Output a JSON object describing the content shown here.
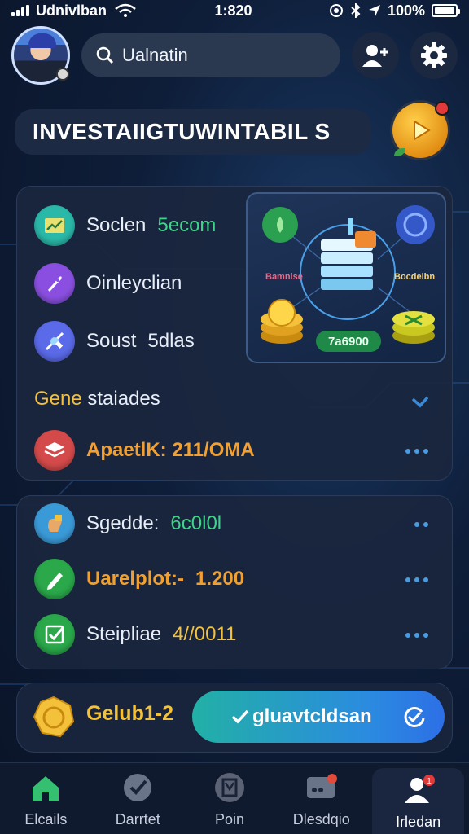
{
  "status_bar": {
    "carrier": "Udnivlban",
    "time": "1:820",
    "battery": "100%"
  },
  "header": {
    "search_placeholder": "Ualnatin"
  },
  "title_card": {
    "title": "INVESTAIIGTUWINTABIL S"
  },
  "panel1": {
    "items": [
      {
        "label": "Soclen",
        "value": "5ecom",
        "value_color": "#3ed48a",
        "icon": "chart-icon",
        "icon_bg": "#2ab8a8"
      },
      {
        "label": "Oinleyclian",
        "value": "",
        "value_color": "#ffffff",
        "icon": "rocket-icon",
        "icon_bg": "#8a4fe0"
      },
      {
        "label": "Soust",
        "value": "5dlas",
        "value_color": "#ffffff",
        "icon": "satellite-icon",
        "icon_bg": "#5a6ae8"
      }
    ],
    "section_label_prefix": "Gene",
    "section_label_rest": "staiades",
    "highlight_row": {
      "label": "ApaetlK: 211/OMA",
      "icon": "stack-icon",
      "icon_bg": "#d44a4a"
    }
  },
  "illustration": {
    "left_label": "Bamnise",
    "right_label": "Bocdelbn",
    "amount": "7a6900"
  },
  "panel2": {
    "items": [
      {
        "label": "Sgedde:",
        "value": "6c0l0l",
        "value_color": "#3ed48a",
        "icon": "hand-icon",
        "icon_bg": "#3a9ad8"
      },
      {
        "label": "Uarelplot:-",
        "value": "1.200",
        "value_color": "#f0a030",
        "icon": "pen-icon",
        "icon_bg": "#2aa84a"
      },
      {
        "label": "Steipliae",
        "value": "4//0011",
        "value_color": "#f3c13a",
        "icon": "checkmark-icon",
        "icon_bg": "#2aa84a"
      }
    ]
  },
  "action": {
    "coin_label": "Gelub1-2",
    "confirm_label": "gluavtcldsan"
  },
  "nav": {
    "items": [
      {
        "label": "Elcails",
        "icon": "home-icon"
      },
      {
        "label": "Darrtet",
        "icon": "check-badge-icon"
      },
      {
        "label": "Poin",
        "icon": "portfolio-icon"
      },
      {
        "label": "Dlesdqio",
        "icon": "message-icon"
      },
      {
        "label": "Irledan",
        "icon": "profile-icon"
      }
    ]
  },
  "colors": {
    "accent_green": "#3ed48a",
    "accent_gold": "#f3c13a",
    "accent_orange": "#f0a030",
    "dots_blue": "#4a9ce0"
  }
}
